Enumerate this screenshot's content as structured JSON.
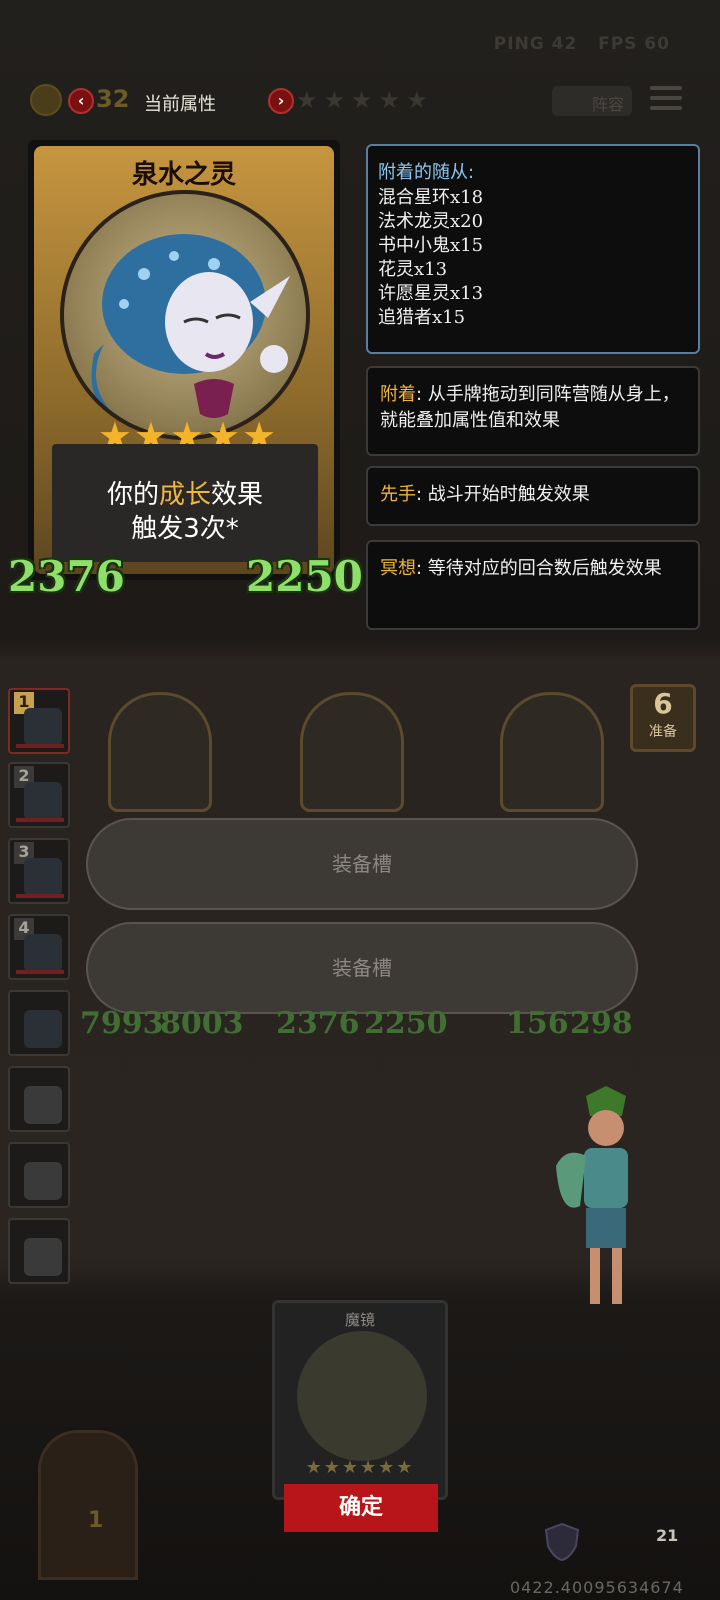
{
  "hud": {
    "ping": "PING 42",
    "fps": "FPS 60",
    "coins": "32",
    "title": "当前属性",
    "lineup": "阵容"
  },
  "card": {
    "name": "泉水之灵",
    "stars": "★★★★★",
    "effect_pre": "你的",
    "effect_highlight": "成长",
    "effect_post": "效果",
    "effect_line2": "触发3次*",
    "attack": "2376",
    "health": "2250"
  },
  "attached": {
    "title": "附着的随从:",
    "minions": [
      "混合星环x18",
      "法术龙灵x20",
      "书中小鬼x15",
      "花灵x13",
      "许愿星灵x13",
      "追猎者x15"
    ]
  },
  "keywords": [
    {
      "name": "附着",
      "text": ": 从手牌拖动到同阵营随从身上，就能叠加属性值和效果"
    },
    {
      "name": "先手",
      "text": ": 战斗开始时触发效果"
    },
    {
      "name": "冥想",
      "text": ": 等待对应的回合数后触发效果"
    }
  ],
  "slots": [
    "装备槽",
    "装备槽"
  ],
  "sidebar": {
    "numbers": [
      "1",
      "2",
      "3",
      "4"
    ]
  },
  "ready": {
    "count": "6",
    "label": "准备"
  },
  "board": {
    "stats_row2": [
      "7993",
      "8003",
      "2376",
      "2250",
      "156",
      "298"
    ]
  },
  "bottom": {
    "card_name": "魔镜",
    "stars": "★★★★★★",
    "confirm": "确定",
    "gate_number": "1",
    "hp": "21"
  },
  "coordinates": "0422.40095634674",
  "colors": {
    "green_stat": "#8ee06a",
    "keyword_gold": "#f1b63a",
    "confirm_red": "#b8151a"
  }
}
